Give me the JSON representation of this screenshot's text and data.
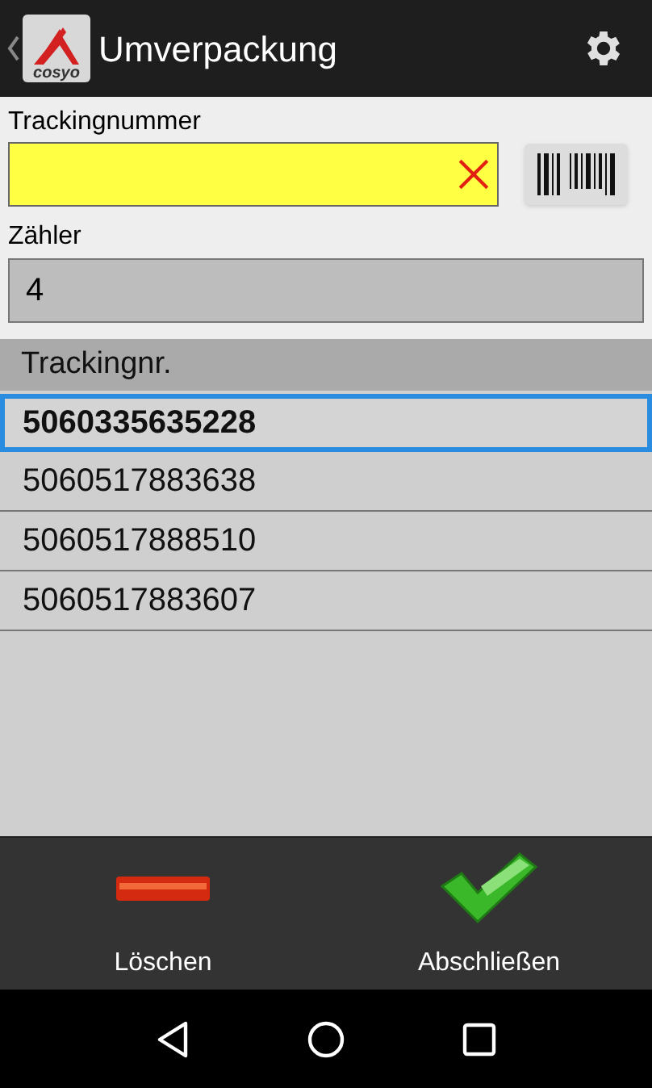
{
  "app_bar": {
    "title": "Umverpackung",
    "logo_text": "cosyo"
  },
  "form": {
    "tracking_label": "Trackingnummer",
    "counter_label": "Zähler",
    "counter_value": "4"
  },
  "table": {
    "columns": [
      "Trackingnr."
    ],
    "rows": [
      {
        "value": "5060335635228",
        "selected": true
      },
      {
        "value": "5060517883638",
        "selected": false
      },
      {
        "value": "5060517888510",
        "selected": false
      },
      {
        "value": "5060517883607",
        "selected": false
      }
    ]
  },
  "actions": [
    {
      "kind": "delete",
      "label": "Löschen"
    },
    {
      "kind": "finish",
      "label": "Abschließen"
    }
  ]
}
